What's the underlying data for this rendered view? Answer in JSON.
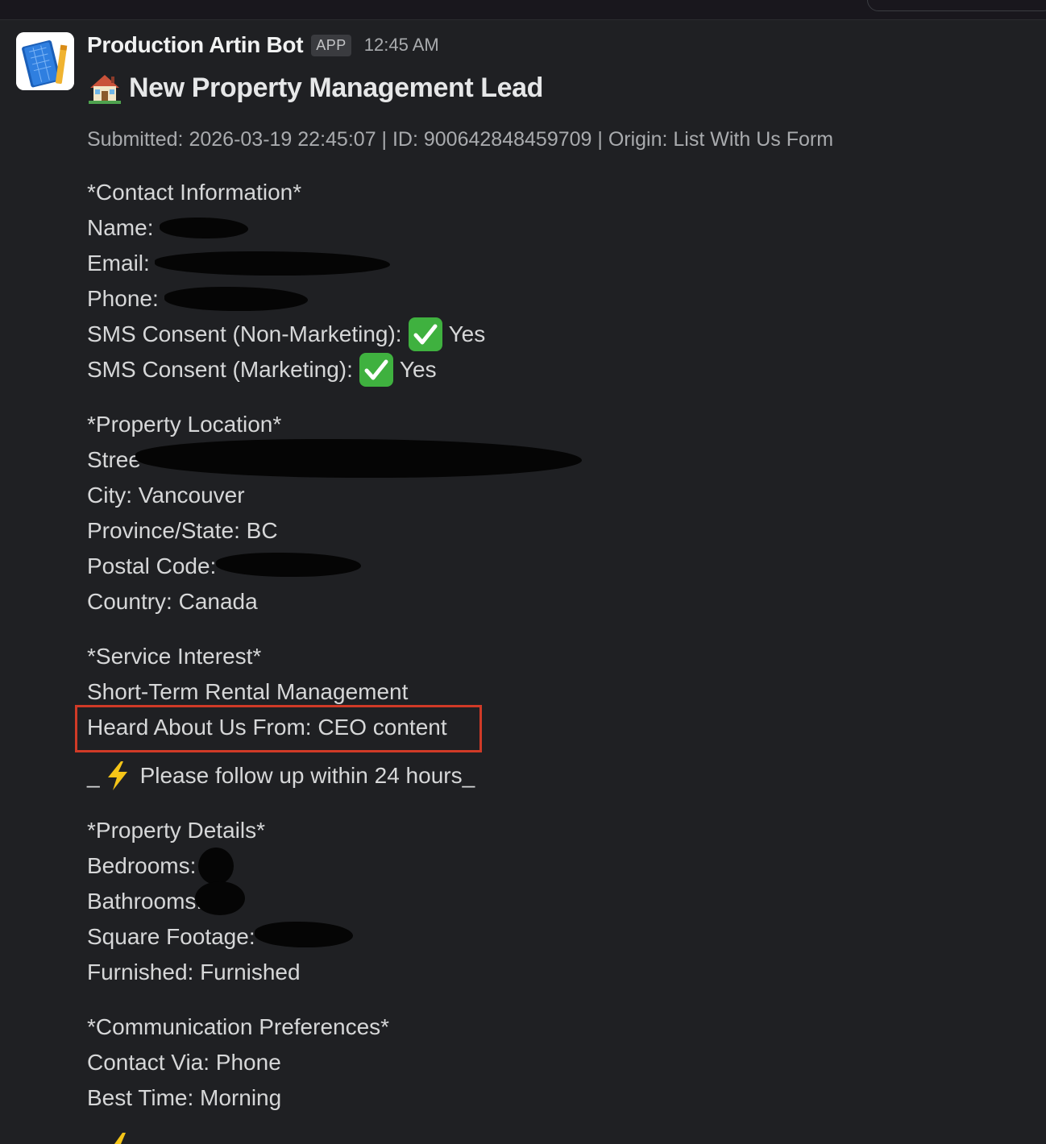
{
  "message": {
    "bot_name": "Production Artin Bot",
    "badge": "APP",
    "timestamp": "12:45 AM",
    "avatar_icon": "blueprint-book-icon",
    "title_icon": "house-with-garden-icon",
    "title": "New Property Management Lead",
    "meta": "Submitted: 2026-03-19 22:45:07 | ID: 900642848459709 | Origin: List With Us Form"
  },
  "contact": {
    "heading": "*Contact Information*",
    "name_label": "Name:",
    "email_label": "Email:",
    "phone_label": "Phone:",
    "sms_non_marketing_label": "SMS Consent (Non-Marketing):",
    "sms_non_marketing_value": "Yes",
    "sms_marketing_label": "SMS Consent (Marketing):",
    "sms_marketing_value": "Yes",
    "check_icon": "white-check-mark-icon"
  },
  "location": {
    "heading": "*Property Location*",
    "street_label": "Stree",
    "city": "City: Vancouver",
    "province": "Province/State: BC",
    "postal_label": "Postal Code:",
    "country": "Country: Canada"
  },
  "service": {
    "heading": "*Service Interest*",
    "interest": "Short-Term Rental Management",
    "heard": "Heard About Us From: CEO content",
    "followup_prefix": "_",
    "followup_icon": "lightning-icon",
    "followup_text": "Please follow up within 24 hours_"
  },
  "details": {
    "heading": "*Property Details*",
    "bedrooms_label": "Bedrooms:",
    "bathrooms_label": "Bathrooms:",
    "sqft_label": "Square Footage:",
    "furnished": "Furnished: Furnished"
  },
  "communication": {
    "heading": "*Communication Preferences*",
    "contact_via": "Contact Via: Phone",
    "best_time": "Best Time: Morning"
  },
  "colors": {
    "background": "#1f2023",
    "highlight_border": "#d03a27",
    "check_green": "#3fb13f"
  }
}
